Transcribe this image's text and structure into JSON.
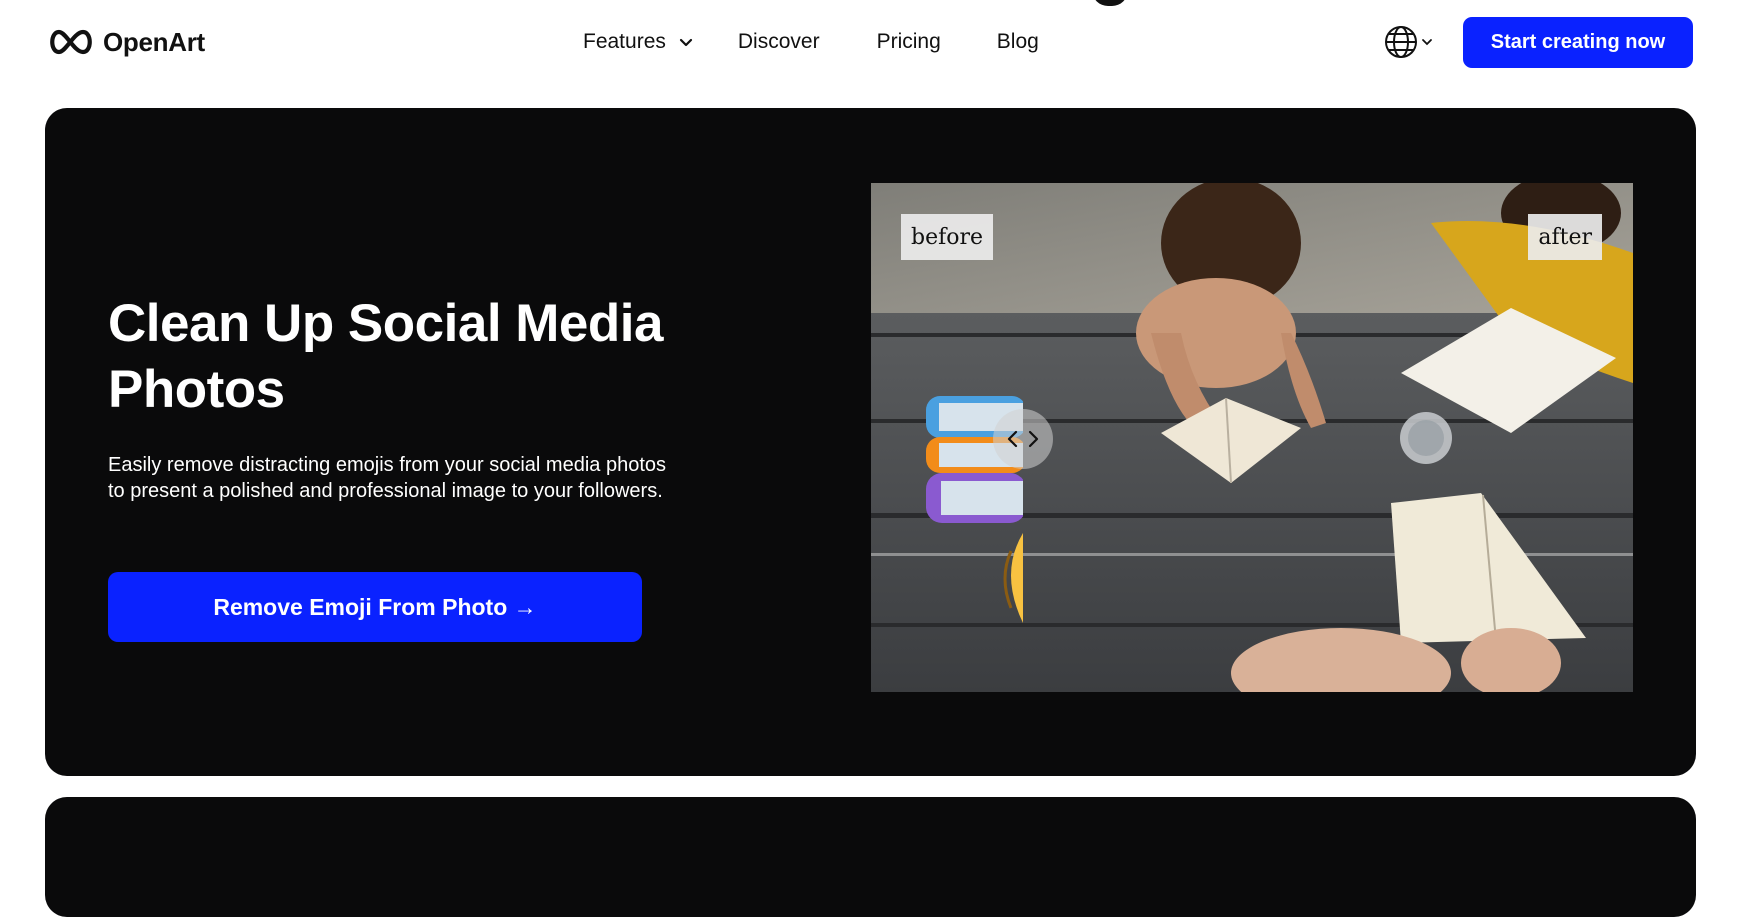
{
  "nav": {
    "logo_text": "OpenArt",
    "links": {
      "features": "Features",
      "discover": "Discover",
      "pricing": "Pricing",
      "blog": "Blog"
    },
    "cta": "Start creating now"
  },
  "hero": {
    "title": "Clean Up Social Media Photos",
    "description": "Easily remove distracting emojis from your social media photos to present a polished and professional image to your followers.",
    "button": "Remove Emoji From Photo →",
    "compare": {
      "before_label": "before",
      "after_label": "after"
    }
  },
  "colors": {
    "accent": "#0a22ff",
    "hero_bg": "#0a0a0b"
  }
}
